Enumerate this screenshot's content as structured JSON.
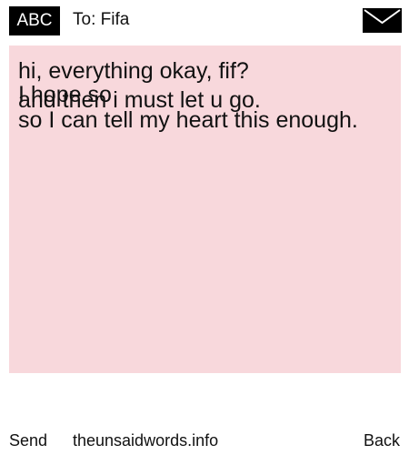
{
  "header": {
    "badge": "ABC",
    "to_text": "To: Fifa",
    "icon": "envelope-icon"
  },
  "message": {
    "background_color": "#f8d8dc",
    "lines": [
      "hi, everything okay, fif?",
      "I hope so",
      "and then i must let u go.",
      "so I can tell my heart this enough."
    ]
  },
  "footer": {
    "send_label": "Send",
    "site_label": "theunsaidwords.info",
    "back_label": "Back"
  }
}
